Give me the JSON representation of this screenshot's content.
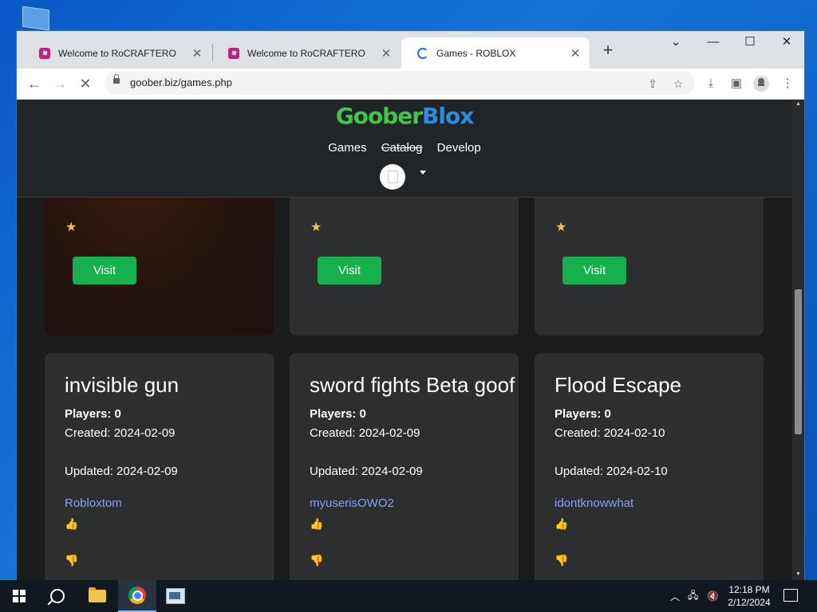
{
  "browser": {
    "tabs": [
      {
        "title": "Welcome to RoCRAFTERO",
        "active": false,
        "favicon": "roblox-icon"
      },
      {
        "title": "Welcome to RoCRAFTERO",
        "active": false,
        "favicon": "roblox-icon"
      },
      {
        "title": "Games - ROBLOX",
        "active": true,
        "favicon": "loading-spinner-icon"
      }
    ],
    "new_tab_label": "+",
    "url": "goober.biz/games.php"
  },
  "site": {
    "logo_part1": "Goober",
    "logo_part2": "Blox",
    "nav": {
      "games": "Games",
      "catalog": "Catalog",
      "develop": "Develop"
    }
  },
  "top_cards": [
    {
      "visit_label": "Visit"
    },
    {
      "visit_label": "Visit"
    },
    {
      "visit_label": "Visit"
    }
  ],
  "games": [
    {
      "title": "invisible gun",
      "players": "Players: 0",
      "created": "Created: 2024-02-09",
      "updated": "Updated: 2024-02-09",
      "author": "Robloxtom"
    },
    {
      "title": "sword fights Beta goof",
      "players": "Players: 0",
      "created": "Created: 2024-02-09",
      "updated": "Updated: 2024-02-09",
      "author": "myuserisOWO2"
    },
    {
      "title": "Flood Escape",
      "players": "Players: 0",
      "created": "Created: 2024-02-10",
      "updated": "Updated: 2024-02-10",
      "author": "idontknowwhat"
    }
  ],
  "taskbar": {
    "time": "12:18 PM",
    "date": "2/12/2024"
  },
  "colors": {
    "page_bg": "#1a1c1e",
    "card_bg": "#2c2e30",
    "visit_button": "#17b04f",
    "author_link": "#8a9ef0",
    "logo_green": "#42c54a",
    "logo_blue": "#2c8de0"
  }
}
